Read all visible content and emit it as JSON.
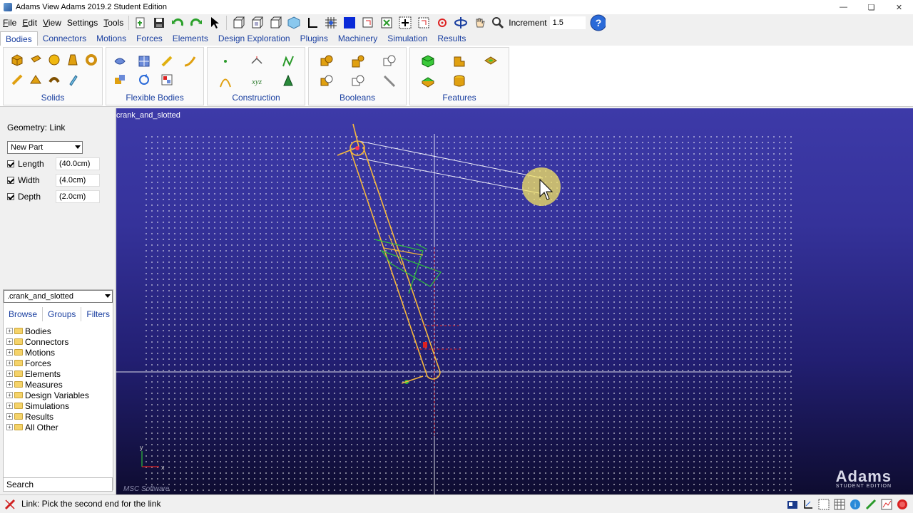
{
  "window": {
    "title": "Adams View Adams 2019.2 Student Edition"
  },
  "menu": {
    "items": [
      {
        "first": "F",
        "rest": "ile"
      },
      {
        "first": "E",
        "rest": "dit"
      },
      {
        "first": "V",
        "rest": "iew"
      },
      {
        "first": "",
        "rest": "Settings"
      },
      {
        "first": "T",
        "rest": "ools"
      }
    ]
  },
  "toolbar": {
    "increment_label": "Increment",
    "increment_value": "1.5"
  },
  "ribbon_tabs": [
    "Bodies",
    "Connectors",
    "Motions",
    "Forces",
    "Elements",
    "Design Exploration",
    "Plugins",
    "Machinery",
    "Simulation",
    "Results"
  ],
  "ribbon_groups": [
    "Solids",
    "Flexible Bodies",
    "Construction",
    "Booleans",
    "Features"
  ],
  "left_panel": {
    "geometry_title": "Geometry: Link",
    "part_option": "New Part",
    "params": [
      {
        "label": "Length",
        "value": "(40.0cm)"
      },
      {
        "label": "Width",
        "value": "(4.0cm)"
      },
      {
        "label": "Depth",
        "value": "(2.0cm)"
      }
    ],
    "model_name": ".crank_and_slotted",
    "browse_tabs": [
      "Browse",
      "Groups",
      "Filters"
    ],
    "tree_items": [
      "Bodies",
      "Connectors",
      "Motions",
      "Forces",
      "Elements",
      "Measures",
      "Design Variables",
      "Simulations",
      "Results",
      "All Other"
    ],
    "search_placeholder": "Search"
  },
  "viewport": {
    "model_label": "crank_and_slotted",
    "logo_text": "Adams",
    "logo_subtext": "STUDENT EDITION",
    "msc_text": "MSC Software",
    "axis_x": "x",
    "axis_y": "y"
  },
  "status": {
    "text": "Link: Pick the second end for the link"
  },
  "colors": {
    "accent": "#1a3fa0",
    "viewport_top": "#3d3aa8",
    "viewport_bottom": "#0e0c30",
    "geometry": "#f5b73b",
    "highlight": "#f5e663"
  }
}
